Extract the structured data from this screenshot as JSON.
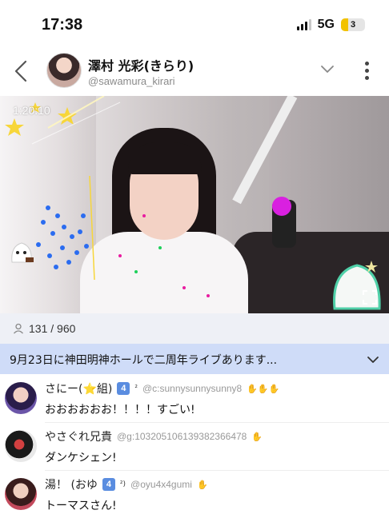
{
  "status": {
    "time": "17:38",
    "network": "5G",
    "battery_level": "3",
    "battery_fraction": 0.3
  },
  "header": {
    "name": "澤村 光彩(きらり)",
    "handle": "@sawamura_kirari",
    "back_icon": "chevron-left-icon",
    "expand_icon": "chevron-down-icon",
    "more_icon": "more-vertical-icon"
  },
  "video": {
    "elapsed": "1:20:10",
    "fullscreen_icon": "fullscreen-icon"
  },
  "viewers": {
    "icon": "person-icon",
    "count": "131 / 960"
  },
  "announcement": {
    "text": "9月23日に神田明神ホールで二周年ライブあります...",
    "icon": "chevron-down-icon",
    "background": "#cfdcf8"
  },
  "comments": [
    {
      "nickname": "さにー(⭐組)",
      "level": "4",
      "level_sup": "²",
      "user_id": "@c:sunnysunnysunny8",
      "hands": "✋✋✋",
      "message": "おおおおおお！！！！すごい!"
    },
    {
      "nickname": "やさぐれ兄貴",
      "level": "",
      "level_sup": "",
      "user_id": "@g:10320510613938236647​8",
      "hands": "✋",
      "message": "ダンケシェン!"
    },
    {
      "nickname": "湯！ (おゆ",
      "level": "4",
      "level_sup": "²)",
      "user_id": "@oyu4x4gumi",
      "hands": "✋",
      "message": "トーマスさん!"
    }
  ]
}
